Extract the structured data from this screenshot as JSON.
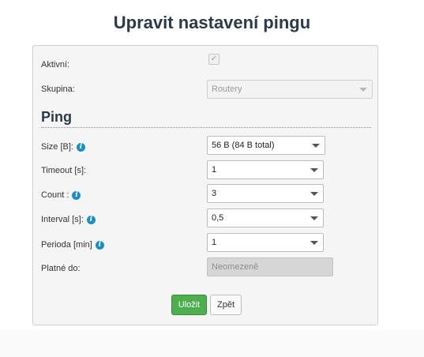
{
  "page": {
    "title": "Upravit nastavení pingu"
  },
  "form": {
    "active": {
      "label": "Aktivní:",
      "checked": true,
      "check_glyph": "✓"
    },
    "group": {
      "label": "Skupina:",
      "value": "Routery"
    },
    "section_title": "Ping",
    "size": {
      "label": "Size [B]:",
      "value": "56 B (84 B total)"
    },
    "timeout": {
      "label": "Timeout [s]:",
      "value": "1"
    },
    "count": {
      "label": "Count :",
      "value": "3"
    },
    "interval": {
      "label": "Interval [s]:",
      "value": "0,5"
    },
    "period": {
      "label": "Perioda [min]",
      "value": "1"
    },
    "valid_until": {
      "label": "Platné do:",
      "placeholder": "Neomezeně"
    }
  },
  "buttons": {
    "save": "Uložit",
    "back": "Zpět"
  },
  "icons": {
    "info": "info-icon",
    "dropdown": "chevron-down-icon",
    "info_glyph": "i"
  },
  "colors": {
    "accent_green": "#4cae4c",
    "info_blue": "#1a8ec6",
    "title": "#2b3a4a"
  }
}
